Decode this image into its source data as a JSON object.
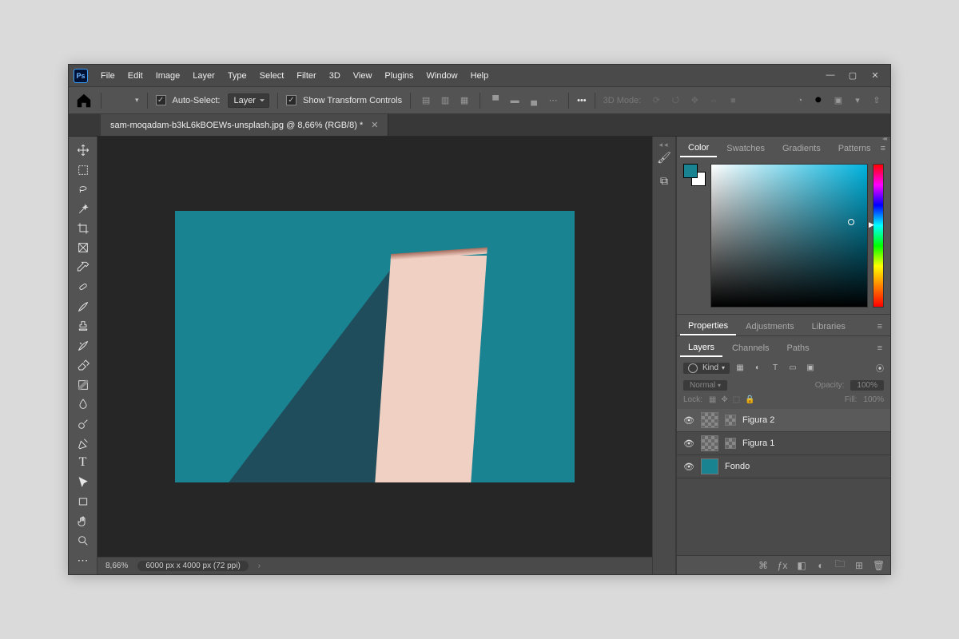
{
  "menubar": {
    "items": [
      "File",
      "Edit",
      "Image",
      "Layer",
      "Type",
      "Select",
      "Filter",
      "3D",
      "View",
      "Plugins",
      "Window",
      "Help"
    ]
  },
  "options": {
    "auto_select_label": "Auto-Select:",
    "auto_select_value": "Layer",
    "show_transform": "Show Transform Controls",
    "mode_label": "3D Mode:"
  },
  "tab": {
    "title": "sam-moqadam-b3kL6kBOEWs-unsplash.jpg @ 8,66% (RGB/8) *"
  },
  "status": {
    "zoom": "8,66%",
    "dimensions": "6000 px x 4000 px (72 ppi)"
  },
  "panels": {
    "color_tabs": [
      "Color",
      "Swatches",
      "Gradients",
      "Patterns"
    ],
    "mid_tabs": [
      "Properties",
      "Adjustments",
      "Libraries"
    ],
    "layer_tabs": [
      "Layers",
      "Channels",
      "Paths"
    ]
  },
  "layers": {
    "kind_label": "Kind",
    "blend_mode": "Normal",
    "opacity_label": "Opacity:",
    "opacity_value": "100%",
    "lock_label": "Lock:",
    "fill_label": "Fill:",
    "fill_value": "100%",
    "items": [
      {
        "name": "Figura 2"
      },
      {
        "name": "Figura 1"
      },
      {
        "name": "Fondo"
      }
    ]
  },
  "tools": [
    "move",
    "marquee",
    "lasso",
    "wand",
    "crop",
    "frame",
    "eyedropper",
    "healing",
    "brush",
    "stamp",
    "history-brush",
    "eraser",
    "gradient",
    "blur",
    "dodge",
    "pen",
    "type",
    "path-select",
    "rectangle",
    "hand",
    "zoom",
    "edit-toolbar"
  ]
}
